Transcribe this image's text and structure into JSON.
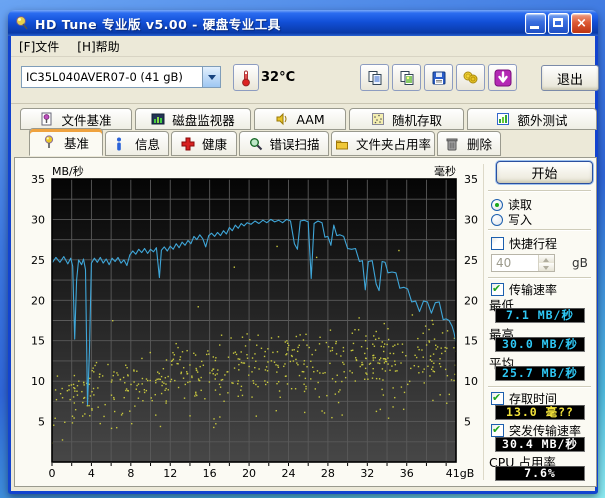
{
  "window": {
    "title": "HD Tune 专业版 v5.00 - 硬盘专业工具"
  },
  "menu": {
    "file": "[F]文件",
    "help": "[H]帮助"
  },
  "toolbar": {
    "drive_selector_value": "IC35L040AVER07-0 (41 gB)",
    "temperature": "32°C",
    "exit_label": "退出"
  },
  "tabs_row1": [
    {
      "label": "文件基准"
    },
    {
      "label": "磁盘监视器"
    },
    {
      "label": "AAM"
    },
    {
      "label": "随机存取"
    },
    {
      "label": "额外测试"
    }
  ],
  "tabs_row2": [
    {
      "label": "基准",
      "active": true
    },
    {
      "label": "信息"
    },
    {
      "label": "健康"
    },
    {
      "label": "错误扫描"
    },
    {
      "label": "文件夹占用率"
    },
    {
      "label": "删除"
    }
  ],
  "panel": {
    "start_label": "开始",
    "read_label": "读取",
    "write_label": "写入",
    "short_stroke_label": "快捷行程",
    "short_stroke_value": "40",
    "short_stroke_unit": "gB",
    "transfer_label": "传输速率",
    "min_label": "最低",
    "min_value": "7.1 MB/秒",
    "max_label": "最高",
    "max_value": "30.0 MB/秒",
    "avg_label": "平均",
    "avg_value": "25.7 MB/秒",
    "access_label": "存取时间",
    "access_value": "13.0 毫??",
    "burst_label": "突发传输速率",
    "burst_value": "30.4 MB/秒",
    "cpu_label": "CPU 占用率",
    "cpu_value": "7.6%",
    "value_colors": {
      "transfer": "#2fc8f5",
      "access": "#f2e23a",
      "burst": "#ffffff",
      "cpu": "#ffffff"
    }
  },
  "chart_data": {
    "type": "line+scatter",
    "x_axis": {
      "min": 0,
      "max": 41,
      "ticks": [
        0,
        4,
        8,
        12,
        16,
        20,
        24,
        28,
        32,
        36
      ],
      "max_label": "41gB",
      "minor_step": 2
    },
    "y_left": {
      "label": "MB/秒",
      "min": 0,
      "max": 35,
      "ticks": [
        35,
        30,
        25,
        20,
        15,
        10,
        5
      ],
      "grid_step": 2.5
    },
    "y_right": {
      "label": "毫秒",
      "ticks": [
        35,
        30,
        25,
        20,
        15,
        10,
        5
      ]
    },
    "plot": {
      "bg_top": "#050505",
      "bg_bottom": "#474747",
      "grid": "#5a5a5a",
      "border": "#000000"
    },
    "series": [
      {
        "name": "传输速率 (MB/秒)",
        "type": "line",
        "color": "#3fa6d8",
        "summary": {
          "min": 7.1,
          "max": 30.0,
          "avg": 25.7
        },
        "points": [
          [
            0,
            24.6
          ],
          [
            0.4,
            25.3
          ],
          [
            0.8,
            24.7
          ],
          [
            1.2,
            25.4
          ],
          [
            1.6,
            24.5
          ],
          [
            1.9,
            25.2
          ],
          [
            2.1,
            24.2
          ],
          [
            2.3,
            15.2
          ],
          [
            2.5,
            22.5
          ],
          [
            2.7,
            25.0
          ],
          [
            3.0,
            24.4
          ],
          [
            3.2,
            25.1
          ],
          [
            3.4,
            23.8
          ],
          [
            3.6,
            7.1
          ],
          [
            3.8,
            13.5
          ],
          [
            4.0,
            24.6
          ],
          [
            4.3,
            25.2
          ],
          [
            4.6,
            24.7
          ],
          [
            4.9,
            25.3
          ],
          [
            5.2,
            24.6
          ],
          [
            5.5,
            25.1
          ],
          [
            5.8,
            24.4
          ],
          [
            6.1,
            25.2
          ],
          [
            6.4,
            24.8
          ],
          [
            6.7,
            25.3
          ],
          [
            7.0,
            24.6
          ],
          [
            7.3,
            25.0
          ],
          [
            7.6,
            24.3
          ],
          [
            7.9,
            25.6
          ],
          [
            8.2,
            26.1
          ],
          [
            8.5,
            25.7
          ],
          [
            8.8,
            26.3
          ],
          [
            9.1,
            25.9
          ],
          [
            9.4,
            26.4
          ],
          [
            9.7,
            25.8
          ],
          [
            10.0,
            26.3
          ],
          [
            10.3,
            26.0
          ],
          [
            10.6,
            26.5
          ],
          [
            10.9,
            22.8
          ],
          [
            11.1,
            26.2
          ],
          [
            11.4,
            26.6
          ],
          [
            11.7,
            26.1
          ],
          [
            12.0,
            26.7
          ],
          [
            12.3,
            26.3
          ],
          [
            12.6,
            27.0
          ],
          [
            12.9,
            26.5
          ],
          [
            13.2,
            27.2
          ],
          [
            13.5,
            26.8
          ],
          [
            13.8,
            27.4
          ],
          [
            14.1,
            27.0
          ],
          [
            14.4,
            27.9
          ],
          [
            14.7,
            27.5
          ],
          [
            15.0,
            28.1
          ],
          [
            15.3,
            27.6
          ],
          [
            15.6,
            26.6
          ],
          [
            15.9,
            28.0
          ],
          [
            16.2,
            28.3
          ],
          [
            16.5,
            27.9
          ],
          [
            16.8,
            28.4
          ],
          [
            17.1,
            28.0
          ],
          [
            17.4,
            28.6
          ],
          [
            17.7,
            28.2
          ],
          [
            18.0,
            29.0
          ],
          [
            18.3,
            28.6
          ],
          [
            18.6,
            29.3
          ],
          [
            18.9,
            28.9
          ],
          [
            19.2,
            29.5
          ],
          [
            19.5,
            29.2
          ],
          [
            19.8,
            29.6
          ],
          [
            20.2,
            29.4
          ],
          [
            20.6,
            29.8
          ],
          [
            21.0,
            29.5
          ],
          [
            21.4,
            29.9
          ],
          [
            21.8,
            29.6
          ],
          [
            22.2,
            30.0
          ],
          [
            22.6,
            29.7
          ],
          [
            23.0,
            29.9
          ],
          [
            23.4,
            29.6
          ],
          [
            23.8,
            30.0
          ],
          [
            24.2,
            29.8
          ],
          [
            24.6,
            27.0
          ],
          [
            24.9,
            26.3
          ],
          [
            25.2,
            29.8
          ],
          [
            25.6,
            29.9
          ],
          [
            26.0,
            29.7
          ],
          [
            26.3,
            22.7
          ],
          [
            26.6,
            29.5
          ],
          [
            27.0,
            29.8
          ],
          [
            27.4,
            29.6
          ],
          [
            27.7,
            27.8
          ],
          [
            28.0,
            27.9
          ],
          [
            28.3,
            26.8
          ],
          [
            28.6,
            29.3
          ],
          [
            28.9,
            28.0
          ],
          [
            29.2,
            28.1
          ],
          [
            29.6,
            27.9
          ],
          [
            30.0,
            26.4
          ],
          [
            30.4,
            26.3
          ],
          [
            30.8,
            26.4
          ],
          [
            31.2,
            24.8
          ],
          [
            31.5,
            24.9
          ],
          [
            31.8,
            21.3
          ],
          [
            32.1,
            24.8
          ],
          [
            32.5,
            24.9
          ],
          [
            32.9,
            22.0
          ],
          [
            33.2,
            21.2
          ],
          [
            33.5,
            24.8
          ],
          [
            33.8,
            24.7
          ],
          [
            34.1,
            23.4
          ],
          [
            34.5,
            23.5
          ],
          [
            34.9,
            23.4
          ],
          [
            35.3,
            21.5
          ],
          [
            35.7,
            21.6
          ],
          [
            36.1,
            21.4
          ],
          [
            36.5,
            19.8
          ],
          [
            36.9,
            19.9
          ],
          [
            37.3,
            18.6
          ],
          [
            37.7,
            19.9
          ],
          [
            38.1,
            19.8
          ],
          [
            38.5,
            18.4
          ],
          [
            38.9,
            19.7
          ],
          [
            39.3,
            19.8
          ],
          [
            39.7,
            17.6
          ],
          [
            40.0,
            17.7
          ],
          [
            40.3,
            17.5
          ],
          [
            40.6,
            16.8
          ],
          [
            40.8,
            16.0
          ],
          [
            41,
            14.8
          ]
        ]
      },
      {
        "name": "存取时间 (毫秒)",
        "type": "scatter",
        "color": "#c8c83e",
        "summary": {
          "avg": 13.0
        },
        "generator": {
          "seed": 20050,
          "count": 560,
          "bands": [
            [
              0,
              3.2,
              11.5
            ],
            [
              3,
              4.5,
              12.5
            ],
            [
              8,
              5.5,
              14
            ],
            [
              14,
              6,
              15.5
            ],
            [
              20,
              6.5,
              16.5
            ],
            [
              28,
              7,
              17.5
            ],
            [
              36,
              7.5,
              18.5
            ],
            [
              41,
              8,
              19
            ]
          ]
        }
      }
    ]
  }
}
